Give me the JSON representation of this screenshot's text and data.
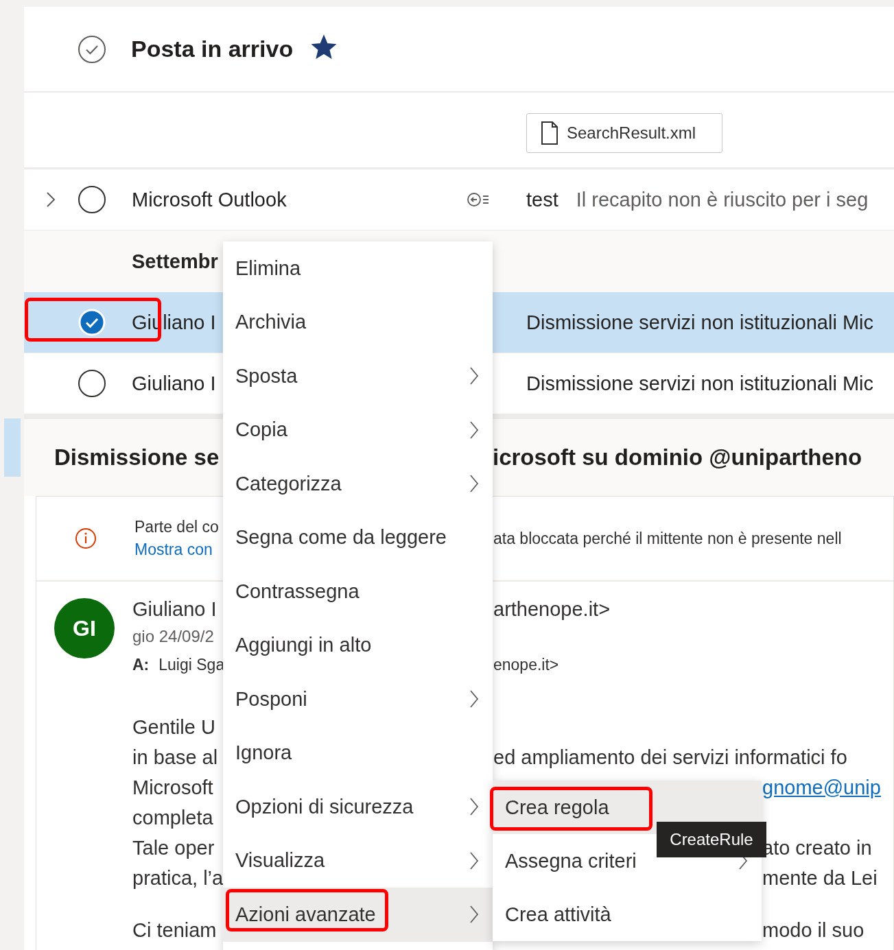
{
  "header": {
    "title": "Posta in arrivo",
    "favorite": true
  },
  "attachment": {
    "name": "SearchResult.xml"
  },
  "message_list": [
    {
      "kind": "message",
      "sender": "Microsoft Outlook",
      "subject": "test",
      "preview": "Il recapito non è riuscito per i seg",
      "expandable": true,
      "checked": false,
      "selected": false,
      "annotated": false
    },
    {
      "kind": "group",
      "label": "Settembr"
    },
    {
      "kind": "message",
      "sender": "Giuliano I",
      "subject": "Dismissione servizi non istituzionali Mic",
      "expandable": false,
      "checked": true,
      "selected": true,
      "annotated": true
    },
    {
      "kind": "message",
      "sender": "Giuliano I",
      "subject": "Dismissione servizi non istituzionali Mic",
      "expandable": false,
      "checked": false,
      "selected": false,
      "annotated": false
    }
  ],
  "reading_pane": {
    "title_left": "Dismissione se",
    "title_right": "icrosoft su dominio @unipartheno",
    "notice": {
      "text_left": "Parte del co",
      "link": "Mostra con",
      "text_right": "ata bloccata perché il mittente non è presente nell"
    },
    "sender": {
      "avatar": "GI",
      "name": "Giuliano I",
      "address_right": "arthenope.it>",
      "date": "gio 24/09/2",
      "to_label": "A:",
      "to": "Luigi Sga",
      "to_right": "enope.it>"
    },
    "body": [
      {
        "left": "Gentile U",
        "paragraph_start": false
      },
      {
        "left": "in base al",
        "right": "ed ampliamento dei servizi informatici fo",
        "right_link": false,
        "paragraph_start": false
      },
      {
        "left": "Microsoft",
        "right": "gnome@unip",
        "right_link": true,
        "paragraph_start": false
      },
      {
        "left": "completa",
        "paragraph_start": false
      },
      {
        "left": "Tale oper",
        "right": "ato creato in",
        "right_link": false,
        "paragraph_start": false
      },
      {
        "left": "pratica, l’a",
        "right": "mente da Lei",
        "right_link": false,
        "paragraph_start": false
      },
      {
        "left": "Ci teniam",
        "right": "modo il suo",
        "right_link": false,
        "paragraph_start": true
      }
    ]
  },
  "context_menu": {
    "items": [
      {
        "label": "Elimina",
        "kind": "action",
        "selected": false,
        "annotated": false
      },
      {
        "label": "Archivia",
        "kind": "action",
        "selected": false,
        "annotated": false
      },
      {
        "label": "Sposta",
        "kind": "submenu",
        "selected": false,
        "annotated": false
      },
      {
        "label": "Copia",
        "kind": "submenu",
        "selected": false,
        "annotated": false
      },
      {
        "label": "Categorizza",
        "kind": "submenu",
        "selected": false,
        "annotated": false
      },
      {
        "label": "Segna come da leggere",
        "kind": "action",
        "selected": false,
        "annotated": false
      },
      {
        "label": "Contrassegna",
        "kind": "action",
        "selected": false,
        "annotated": false
      },
      {
        "label": "Aggiungi in alto",
        "kind": "action",
        "selected": false,
        "annotated": false
      },
      {
        "label": "Posponi",
        "kind": "submenu",
        "selected": false,
        "annotated": false
      },
      {
        "label": "Ignora",
        "kind": "action",
        "selected": false,
        "annotated": false
      },
      {
        "label": "Opzioni di sicurezza",
        "kind": "submenu",
        "selected": false,
        "annotated": false
      },
      {
        "label": "Visualizza",
        "kind": "submenu",
        "selected": false,
        "annotated": false
      },
      {
        "label": "Azioni avanzate",
        "kind": "submenu",
        "selected": true,
        "annotated": true
      }
    ]
  },
  "submenu": {
    "items": [
      {
        "label": "Crea regola",
        "kind": "action",
        "selected": true,
        "annotated": true
      },
      {
        "label": "Assegna criteri",
        "kind": "submenu",
        "selected": false,
        "annotated": false
      },
      {
        "label": "Crea attività",
        "kind": "action",
        "selected": false,
        "annotated": false
      }
    ]
  },
  "tooltip": {
    "text": "CreateRule"
  }
}
